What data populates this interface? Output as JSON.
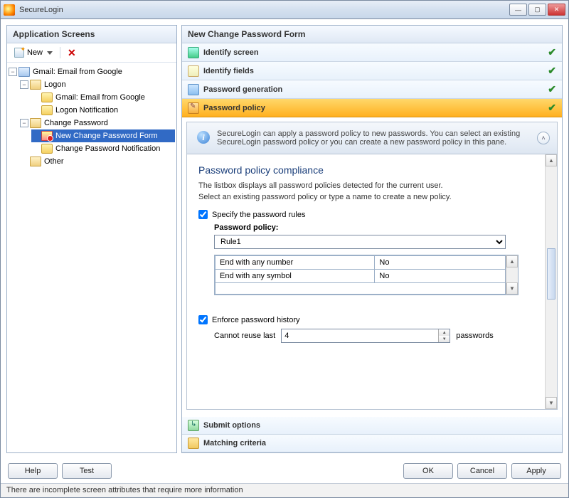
{
  "window": {
    "title": "SecureLogin"
  },
  "left": {
    "title": "Application Screens",
    "toolbar": {
      "new_label": "New"
    },
    "tree": {
      "root": "Gmail: Email from Google",
      "logon": "Logon",
      "logon_form": "Gmail: Email from Google",
      "logon_notif": "Logon Notification",
      "change_pw": "Change Password",
      "new_change_pw_form": "New Change Password Form",
      "change_pw_notif": "Change Password Notification",
      "other": "Other"
    }
  },
  "right": {
    "title": "New Change Password Form",
    "steps": {
      "identify_screen": "Identify screen",
      "identify_fields": "Identify fields",
      "password_generation": "Password generation",
      "password_policy": "Password policy",
      "submit_options": "Submit options",
      "matching_criteria": "Matching criteria"
    },
    "info": "SecureLogin can apply a password policy to new passwords. You can select an existing SecureLogin password policy or you can create a new password policy in this pane.",
    "compliance": {
      "heading": "Password policy compliance",
      "desc1": "The listbox displays all password policies detected for the current user.",
      "desc2": "Select an existing password policy or type a name to create a new policy.",
      "specify_rules_label": "Specify the password rules",
      "specify_rules_checked": true,
      "policy_label": "Password policy:",
      "policy_value": "Rule1",
      "rules": [
        {
          "name": "End with any number",
          "value": "No"
        },
        {
          "name": "End with any symbol",
          "value": "No"
        }
      ],
      "enforce_history_label": "Enforce password history",
      "enforce_history_checked": true,
      "history_pre": "Cannot reuse last",
      "history_value": "4",
      "history_post": "passwords"
    }
  },
  "buttons": {
    "help": "Help",
    "test": "Test",
    "ok": "OK",
    "cancel": "Cancel",
    "apply": "Apply"
  },
  "status": "There are incomplete screen attributes that require more information"
}
